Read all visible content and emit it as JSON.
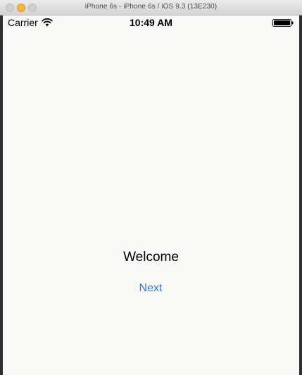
{
  "window": {
    "title": "iPhone 6s - iPhone 6s / iOS 9.3 (13E230)"
  },
  "status_bar": {
    "carrier": "Carrier",
    "time": "10:49 AM",
    "wifi_icon": "wifi-icon",
    "battery_icon": "battery-icon"
  },
  "screen": {
    "welcome_text": "Welcome",
    "next_label": "Next"
  },
  "colors": {
    "accent": "#2a7ae2",
    "background": "#f9f9f8",
    "text": "#000000"
  }
}
